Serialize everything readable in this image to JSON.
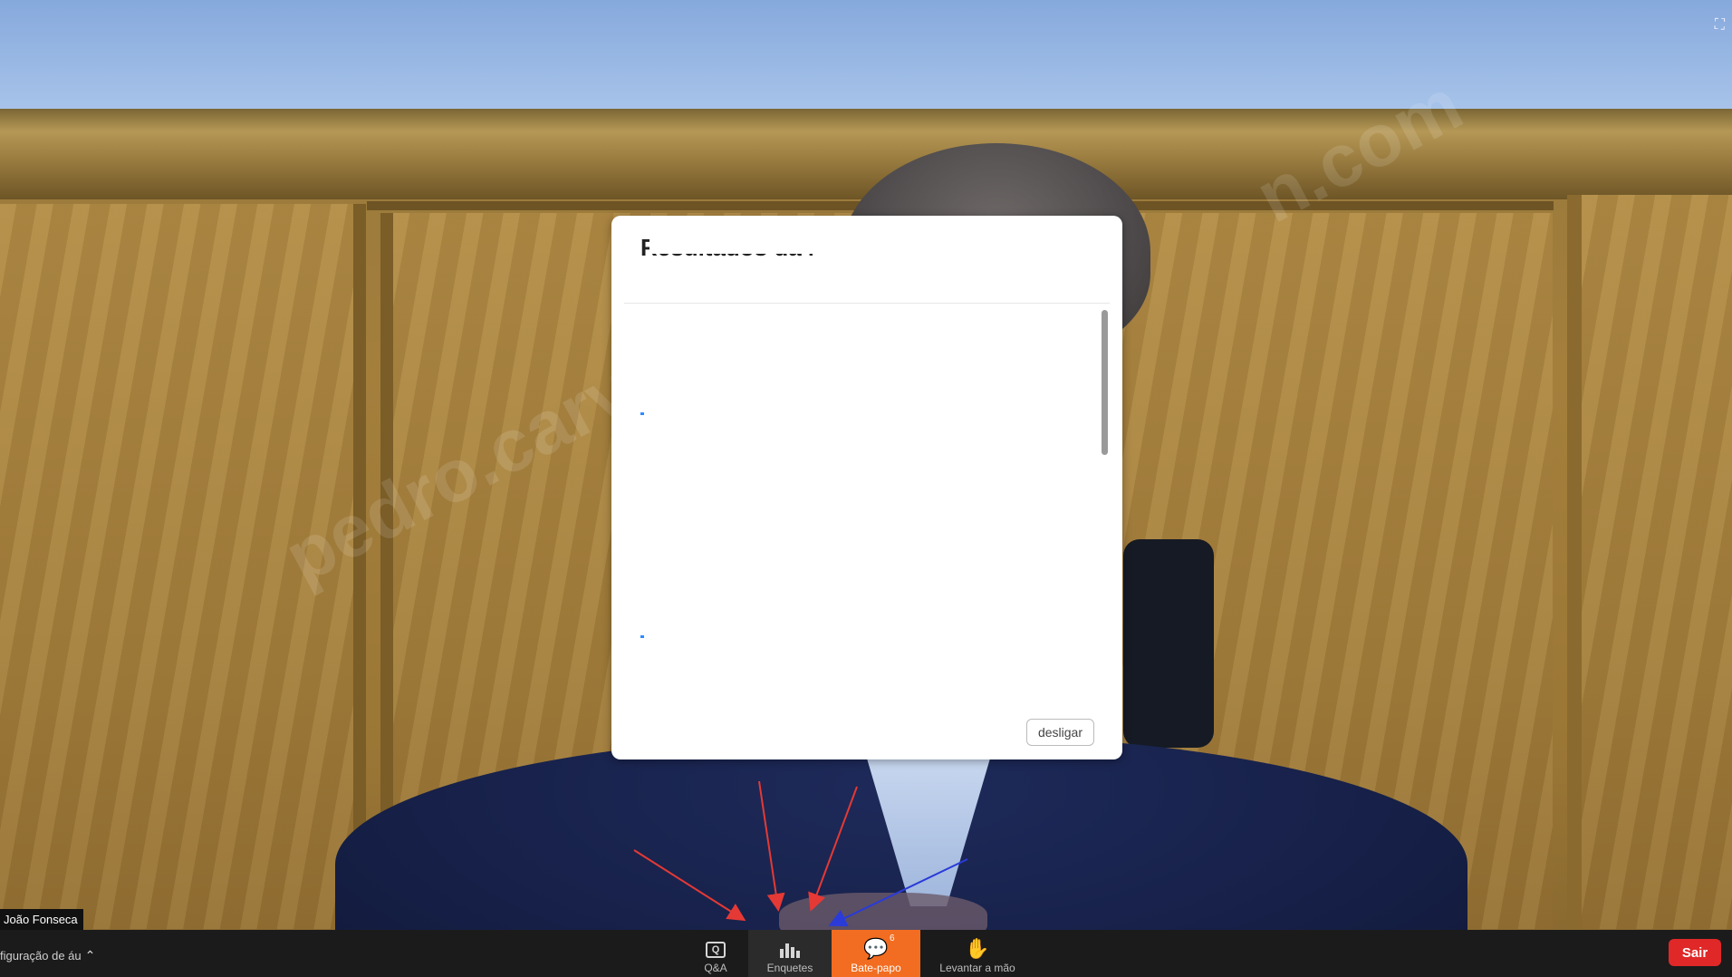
{
  "video": {
    "participant_name": "João Fonseca",
    "watermark": "pedro.carva",
    "watermark_top": "n.com"
  },
  "dialog": {
    "title": "Resultados da Enquete",
    "subtitle": "",
    "close_label": "desligar"
  },
  "toolbar": {
    "audio_settings_label": "figuração de áu",
    "buttons": {
      "qa_label": "Q&A",
      "polls_label": "Enquetes",
      "chat_label": "Bate-papo",
      "chat_badge": "6",
      "raise_hand_label": "Levantar a mão"
    },
    "leave_label": "Sair"
  },
  "colors": {
    "chat_active": "#f26d21",
    "leave": "#e02828",
    "toolbar_bg": "#1b1b1b",
    "arrow_red": "#e53935",
    "arrow_blue": "#2a3bd8"
  },
  "icons": {
    "qa": "qa-icon",
    "polls": "bar-chart-icon",
    "chat": "chat-bubble-icon",
    "raise_hand": "hand-icon",
    "fullscreen": "fullscreen-icon",
    "audio_chevron": "chevron-up-icon"
  }
}
